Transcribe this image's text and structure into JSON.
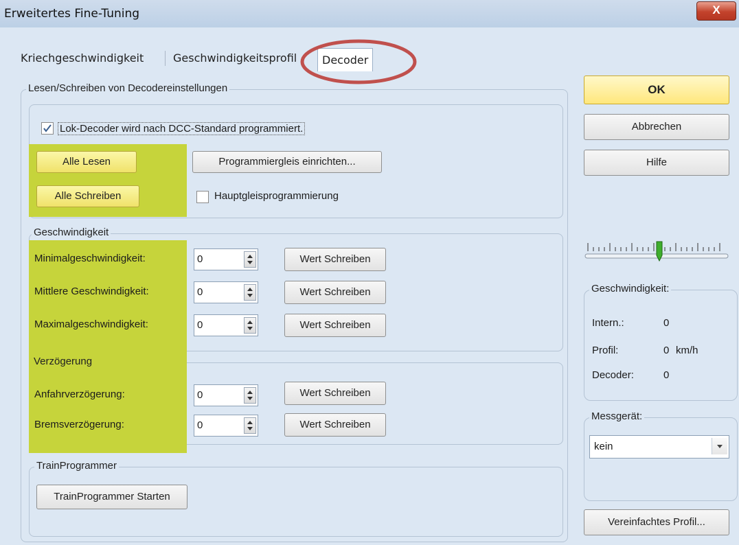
{
  "window": {
    "title": "Erweitertes Fine-Tuning",
    "close_label": "X"
  },
  "tabs": [
    {
      "label": "Kriechgeschwindigkeit"
    },
    {
      "label": "Geschwindigkeitsprofil"
    },
    {
      "label": "Decoder"
    }
  ],
  "rw_group": {
    "label": "Lesen/Schreiben von Decodereinstellungen",
    "checkbox_label": "Lok-Decoder wird nach DCC-Standard programmiert.",
    "checkbox_checked": true,
    "read_all": "Alle Lesen",
    "write_all": "Alle Schreiben",
    "setup_track": "Programmiergleis einrichten...",
    "main_track_label": "Hauptgleisprogrammierung",
    "main_track_checked": false
  },
  "speed_group": {
    "label": "Geschwindigkeit",
    "rows": [
      {
        "label": "Minimalgeschwindigkeit:",
        "value": "0",
        "button": "Wert Schreiben"
      },
      {
        "label": "Mittlere Geschwindigkeit:",
        "value": "0",
        "button": "Wert Schreiben"
      },
      {
        "label": "Maximalgeschwindigkeit:",
        "value": "0",
        "button": "Wert Schreiben"
      }
    ]
  },
  "delay_group": {
    "label": "Verzögerung",
    "rows": [
      {
        "label": "Anfahrverzögerung:",
        "value": "0",
        "button": "Wert Schreiben"
      },
      {
        "label": "Bremsverzögerung:",
        "value": "0",
        "button": "Wert Schreiben"
      }
    ]
  },
  "train_group": {
    "label": "TrainProgrammer",
    "button": "TrainProgrammer Starten"
  },
  "right": {
    "ok": "OK",
    "cancel": "Abbrechen",
    "help": "Hilfe",
    "speed_box": {
      "label": "Geschwindigkeit:",
      "intern_label": "Intern.:",
      "intern_value": "0",
      "profil_label": "Profil:",
      "profil_value": "0",
      "profil_unit": "km/h",
      "decoder_label": "Decoder:",
      "decoder_value": "0"
    },
    "meter_box": {
      "label": "Messgerät:",
      "selected": "kein"
    },
    "simplified_profile": "Vereinfachtes Profil..."
  },
  "colors": {
    "highlight": "#c6d43b",
    "annotation": "#c0504d",
    "window_bg": "#dce7f3"
  },
  "icons": [
    "checkbox-icon",
    "spin-arrows-icon",
    "dropdown-arrow-icon",
    "slider-thumb-icon",
    "close-icon"
  ]
}
